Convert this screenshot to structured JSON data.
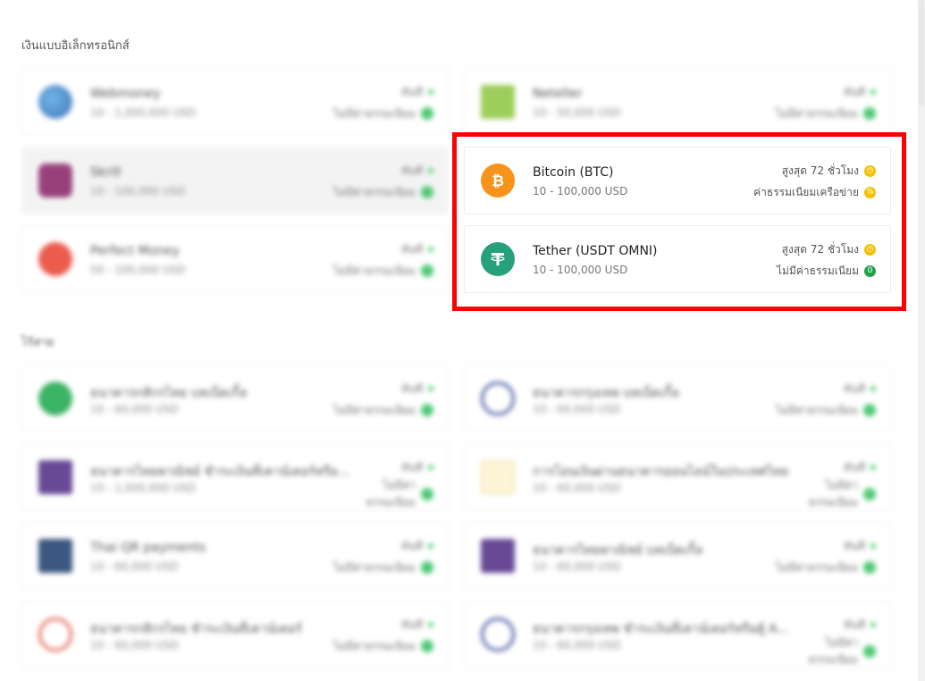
{
  "sections": {
    "ewallet_title": "เงินแบบอิเล็กทรอนิกส์",
    "bank_title": "ไร้สาย"
  },
  "ewallet": [
    {
      "name": "Webmoney",
      "range": "10 - 1,000,000 USD",
      "meta1": "ทันที",
      "meta2": "ไม่มีค่าธรรมเนียม"
    },
    {
      "name": "Neteller",
      "range": "10 - 50,000 USD",
      "meta1": "ทันที",
      "meta2": "ไม่มีค่าธรรมเนียม"
    },
    {
      "name": "Skrill",
      "range": "10 - 100,000 USD",
      "meta1": "ทันที",
      "meta2": "ไม่มีค่าธรรมเนียม"
    },
    {
      "name": "Perfect Money",
      "range": "50 - 100,000 USD",
      "meta1": "ทันที",
      "meta2": "ไม่มีค่าธรรมเนียม"
    }
  ],
  "crypto": [
    {
      "name": "Bitcoin (BTC)",
      "range": "10 - 100,000 USD",
      "time": "สูงสุด 72 ชั่วโมง",
      "fee": "ค่าธรรมเนียมเครือข่าย",
      "fee_icon": "%"
    },
    {
      "name": "Tether (USDT OMNI)",
      "range": "10 - 100,000 USD",
      "time": "สูงสุด 72 ชั่วโมง",
      "fee": "ไม่มีค่าธรรมเนียม",
      "fee_icon": "0"
    }
  ],
  "banks": [
    {
      "name": "ธนาคารกสิกรไทย บทเบ็ดเกิ้ล",
      "range": "10 - 60,000 USD",
      "meta1": "ทันที",
      "meta2": "ไม่มีค่าธรรมเนียม"
    },
    {
      "name": "ธนาคารกรุงเทพ บทเบ็ดเกิ้ล",
      "range": "10 - 60,000 USD",
      "meta1": "ทันที",
      "meta2": "ไม่มีค่าธรรมเนียม"
    },
    {
      "name": "ธนาคารไทยพาณิชย์ ชำระเงินที่เคาน์เตอร์หรือ...",
      "range": "10 - 1,000,000 USD",
      "meta1": "ทันที",
      "meta2": "ไม่มีค่า ธรรมเนียม"
    },
    {
      "name": "การโอนเงินผ่านธนาคารออนไลน์ในประเทศไทย",
      "range": "10 - 60,000 USD",
      "meta1": "ทันที",
      "meta2": "ไม่มีค่า ธรรมเนียม"
    },
    {
      "name": "Thai QR payments",
      "range": "10 - 60,000 USD",
      "meta1": "ทันที",
      "meta2": "ไม่มีค่าธรรมเนียม"
    },
    {
      "name": "ธนาคารไทยพาณิชย์ บทเบ็ดเกิ้ล",
      "range": "10 - 60,000 USD",
      "meta1": "ทันที",
      "meta2": "ไม่มีค่าธรรมเนียม"
    },
    {
      "name": "ธนาคารกสิกรไทย ชำระเงินที่เคาน์เตอร์",
      "range": "10 - 60,000 USD",
      "meta1": "ทันที",
      "meta2": "ไม่มีค่าธรรมเนียม"
    },
    {
      "name": "ธนาคารกรุงเทพ ชำระเงินที่เคาน์เตอร์หรือตู้ A...",
      "range": "10 - 60,000 USD",
      "meta1": "ทันที",
      "meta2": "ไม่มีค่า ธรรมเนียม"
    }
  ],
  "colors": {
    "highlight": "#ff0000",
    "bitcoin": "#f7931a",
    "tether": "#26a17b",
    "clock": "#f5c000",
    "free": "#1fa34a"
  }
}
